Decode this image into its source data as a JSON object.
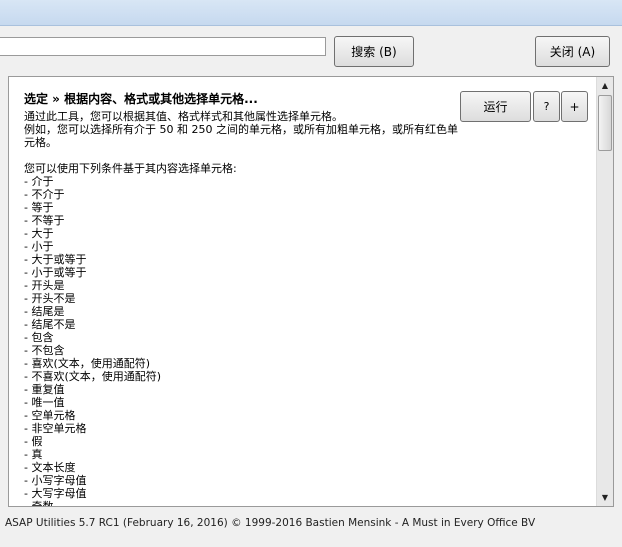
{
  "toolbar": {
    "search_value": "",
    "search_button": "搜索 (B)",
    "close_button": "关闭 (A)"
  },
  "panel": {
    "run_button": "运行",
    "help_button": "?",
    "plus_button": "+"
  },
  "document": {
    "title": "选定 » 根据内容、格式或其他选择单元格...",
    "intro": "通过此工具，您可以根据其值、格式样式和其他属性选择单元格。",
    "example": "例如，您可以选择所有介于 50 和 250 之间的单元格，或所有加粗单元格，或所有红色单元格。",
    "list_intro": "您可以使用下列条件基于其内容选择单元格:",
    "conditions": [
      "- 介于",
      "- 不介于",
      "- 等于",
      "- 不等于",
      "- 大于",
      "- 小于",
      "- 大于或等于",
      "- 小于或等于",
      "- 开头是",
      "- 开头不是",
      "- 结尾是",
      "- 结尾不是",
      "- 包含",
      "- 不包含",
      "- 喜欢(文本，使用通配符)",
      "- 不喜欢(文本，使用通配符)",
      "- 重复值",
      "- 唯一值",
      "- 空单元格",
      "- 非空单元格",
      "- 假",
      "- 真",
      "- 文本长度",
      "- 小写字母值",
      "- 大写字母值",
      "- 奇数"
    ]
  },
  "status": {
    "text": "ASAP Utilities 5.7 RC1 (February 16, 2016)  © 1999-2016 Bastien Mensink - A Must in Every Office BV"
  },
  "icons": {
    "scroll_up": "triangle-up",
    "scroll_down": "triangle-down"
  }
}
